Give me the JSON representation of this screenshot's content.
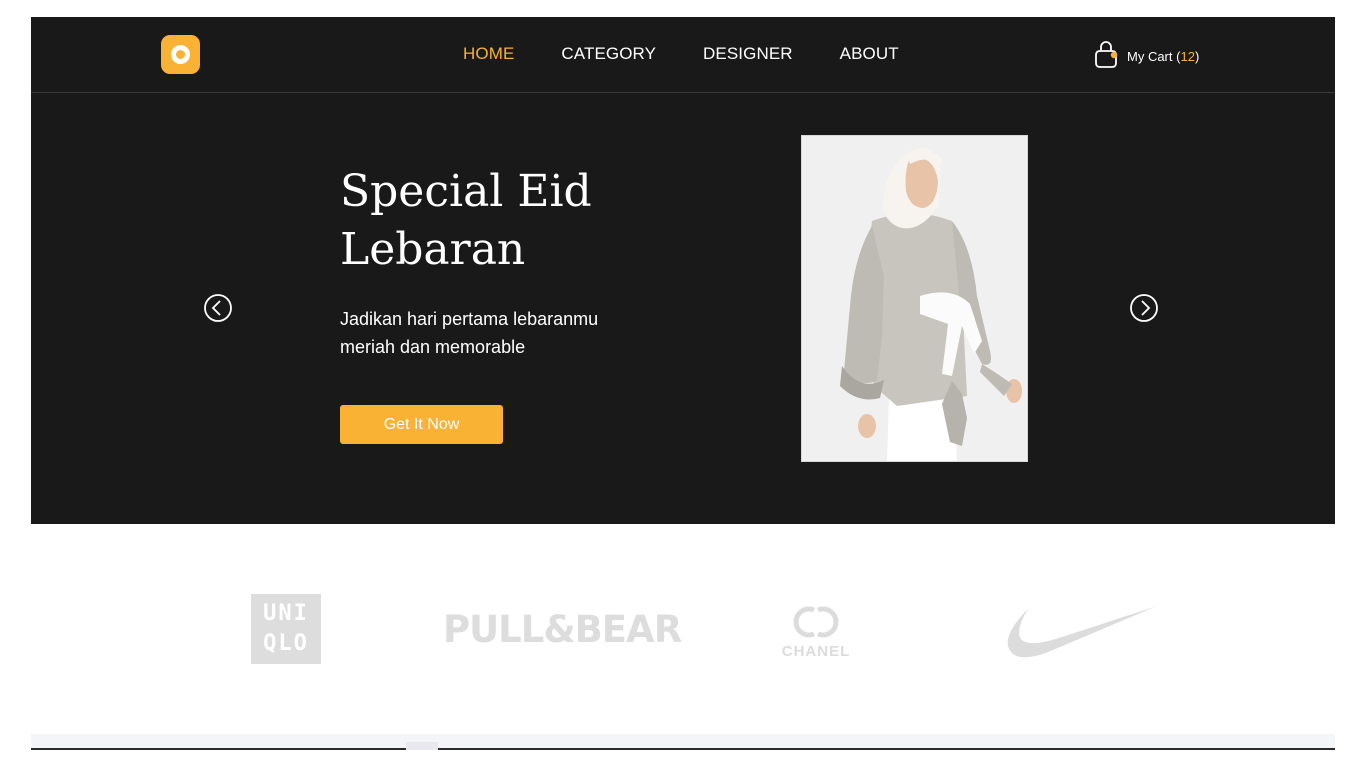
{
  "header": {
    "logo": "logo-ring-icon",
    "nav": [
      {
        "label": "HOME",
        "active": true
      },
      {
        "label": "CATEGORY",
        "active": false
      },
      {
        "label": "DESIGNER",
        "active": false
      },
      {
        "label": "ABOUT",
        "active": false
      }
    ],
    "cart": {
      "label": "My Cart",
      "open": "(",
      "count": "12",
      "close": ")",
      "icon": "shopping-bag-icon"
    }
  },
  "hero": {
    "title_line1": "Special Eid",
    "title_line2": "Lebaran",
    "subtitle_line1": "Jadikan hari pertama lebaranmu",
    "subtitle_line2": "meriah dan memorable",
    "cta_label": "Get It Now",
    "prev_icon": "chevron-left-circle-icon",
    "next_icon": "chevron-right-circle-icon"
  },
  "brands": {
    "uniqlo_line1": "UNI",
    "uniqlo_line2": "QLO",
    "pullbear": "PULL&BEAR",
    "chanel": "CHANEL",
    "nike": "nike-swoosh-logo"
  },
  "colors": {
    "accent": "#f9b234",
    "dark_bg": "#1a1919",
    "brand_logo_gray": "#dddddd"
  }
}
